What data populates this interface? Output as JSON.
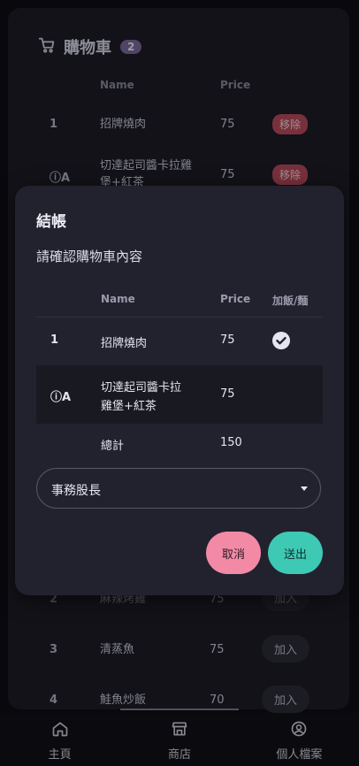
{
  "cart": {
    "title": "購物車",
    "count": "2",
    "col_name": "Name",
    "col_price": "Price",
    "items": [
      {
        "idx": "1",
        "name": "招牌燒肉",
        "price": "75",
        "action": "移除"
      },
      {
        "idx": "ⓘA",
        "name": "切達起司醬卡拉雞堡+紅茶",
        "price": "75",
        "action": "移除"
      }
    ]
  },
  "menu": {
    "items": [
      {
        "idx": "2",
        "name": "麻辣烤雞",
        "price": "75",
        "action": "加入"
      },
      {
        "idx": "3",
        "name": "清蒸魚",
        "price": "75",
        "action": "加入"
      },
      {
        "idx": "4",
        "name": "鮭魚炒飯",
        "price": "70",
        "action": "加入"
      }
    ]
  },
  "dialog": {
    "title": "結帳",
    "subtitle": "請確認購物車內容",
    "col_name": "Name",
    "col_price": "Price",
    "col_extra": "加飯/麵",
    "rows": [
      {
        "idx": "1",
        "name": "招牌燒肉",
        "price": "75",
        "extra": true
      },
      {
        "idx": "ⓘA",
        "name_line1": "切達起司醬卡拉",
        "name_line2": "雞堡+紅茶",
        "price": "75",
        "extra": false
      }
    ],
    "total_label": "總計",
    "total_value": "150",
    "select_value": "事務股長",
    "cancel_label": "取消",
    "submit_label": "送出"
  },
  "nav": {
    "home": "主頁",
    "shop": "商店",
    "profile": "個人檔案"
  },
  "colors": {
    "remove": "#b94a5c",
    "cancel": "#f28aa6",
    "submit": "#3ec9b5",
    "badge": "#7b6a9b"
  }
}
